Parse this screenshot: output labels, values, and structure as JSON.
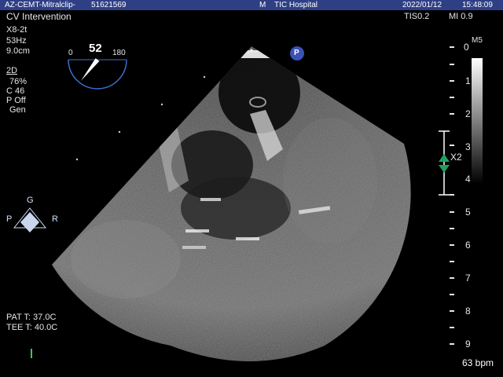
{
  "header": {
    "patient_id": "AZ-CEMT-Mitralclip-",
    "patient_num": "51621569",
    "mode_letter": "M",
    "hospital": "TIC Hospital",
    "date": "2022/01/12",
    "time": "15:48:09"
  },
  "study": {
    "name": "CV Intervention",
    "tis": "TIS0.2",
    "mi": "MI 0.9"
  },
  "probe": {
    "name": "X8-2t",
    "frame_rate": "53Hz",
    "depth": "9.0cm"
  },
  "mode_params": {
    "mode": "2D",
    "gain": "76%",
    "compression": "C 46",
    "persist": "P Off",
    "res": "Gen"
  },
  "angle": {
    "value": "52",
    "min_label": "0",
    "max_label": "180",
    "fraction": 0.289
  },
  "p_marker": "P",
  "orientation": {
    "top": "G",
    "left": "P",
    "right": "R"
  },
  "grayscale": {
    "map_label": "M5",
    "ticks": [
      "1",
      "2"
    ]
  },
  "depth_scale": {
    "labels": [
      "0",
      "3",
      "4",
      "5",
      "6",
      "7",
      "8",
      "9"
    ]
  },
  "focus_label": "X2",
  "temps": {
    "pat": "PAT T: 37.0C",
    "tee": "TEE T: 40.0C"
  },
  "heart_rate": "63 bpm",
  "colors": {
    "header_bg": "#2f3f86",
    "focus_green": "#1fa060",
    "p_marker_blue": "#3a52b8"
  },
  "icons": {
    "angle_pointer": "needle-icon",
    "orientation": "probe-orientation-diamond-icon",
    "focus": "focus-arrows-icon"
  }
}
